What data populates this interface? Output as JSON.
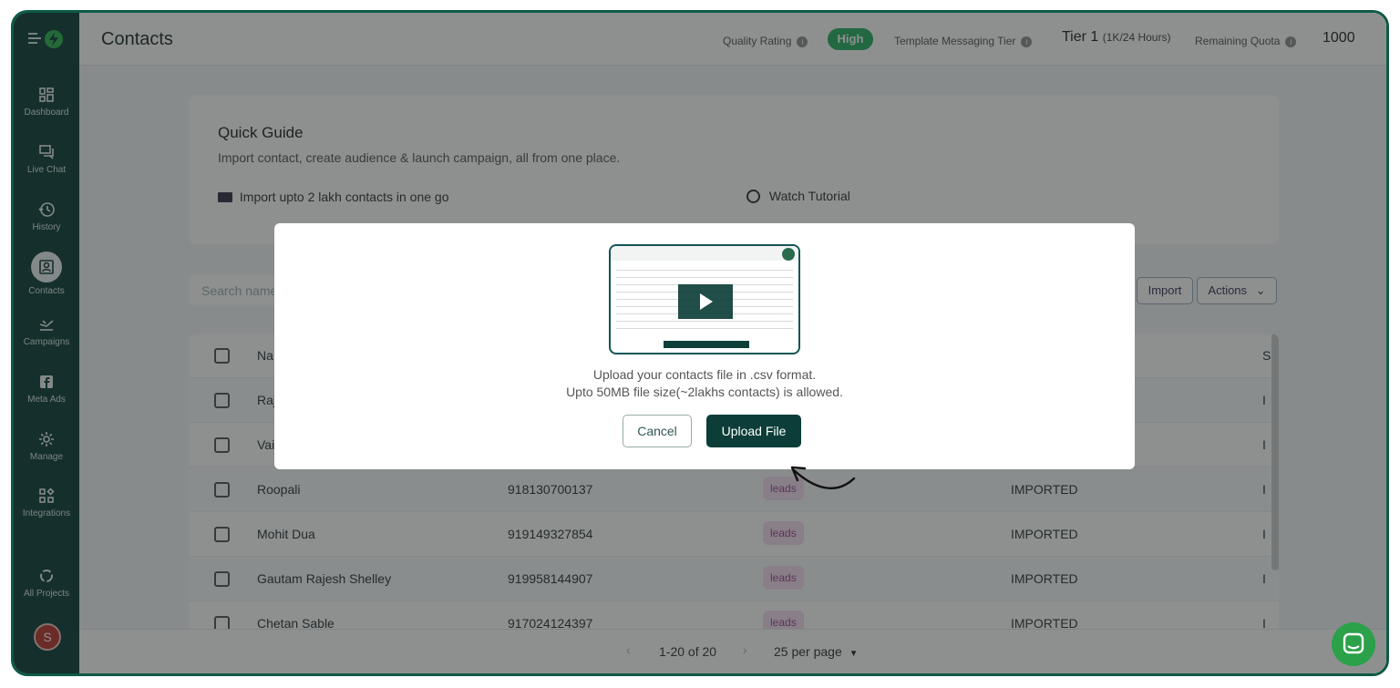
{
  "header": {
    "page_title": "Contacts",
    "quality_rating_label": "Quality Rating",
    "quality_rating_value": "High",
    "template_tier_label": "Template Messaging Tier",
    "tier_value": "Tier 1",
    "tier_detail": "(1K/24 Hours)",
    "remaining_quota_label": "Remaining Quota",
    "remaining_quota_value": "1000"
  },
  "sidebar": {
    "items": [
      {
        "label": "Dashboard",
        "icon": "dashboard-icon"
      },
      {
        "label": "Live Chat",
        "icon": "chat-icon"
      },
      {
        "label": "History",
        "icon": "history-icon"
      },
      {
        "label": "Contacts",
        "icon": "contacts-icon"
      },
      {
        "label": "Campaigns",
        "icon": "campaigns-icon"
      },
      {
        "label": "Meta Ads",
        "icon": "facebook-icon"
      },
      {
        "label": "Manage",
        "icon": "gear-icon"
      },
      {
        "label": "Integrations",
        "icon": "integrations-icon"
      },
      {
        "label": "All Projects",
        "icon": "projects-icon"
      }
    ],
    "avatar_initial": "S"
  },
  "guide": {
    "title": "Quick Guide",
    "subtitle": "Import contact, create audience & launch campaign, all from one place.",
    "import_link": "Import upto 2 lakh contacts in one go",
    "tutorial_link": "Watch Tutorial"
  },
  "toolbar": {
    "search_placeholder": "Search name",
    "import_label": "Import",
    "actions_label": "Actions"
  },
  "table": {
    "header_first": "Na",
    "header_last": "S",
    "rows": [
      {
        "name": "Raj",
        "phone": "",
        "tag": "",
        "status": "",
        "extra": "I"
      },
      {
        "name": "Vai",
        "phone": "",
        "tag": "",
        "status": "",
        "extra": "I"
      },
      {
        "name": "Roopali",
        "phone": "918130700137",
        "tag": "leads",
        "status": "IMPORTED",
        "extra": "I"
      },
      {
        "name": "Mohit Dua",
        "phone": "919149327854",
        "tag": "leads",
        "status": "IMPORTED",
        "extra": "I"
      },
      {
        "name": "Gautam Rajesh Shelley",
        "phone": "919958144907",
        "tag": "leads",
        "status": "IMPORTED",
        "extra": "I"
      },
      {
        "name": "Chetan Sable",
        "phone": "917024124397",
        "tag": "leads",
        "status": "IMPORTED",
        "extra": "I"
      }
    ]
  },
  "pager": {
    "range": "1-20 of 20",
    "per_page": "25 per page"
  },
  "modal": {
    "line1": "Upload your contacts file in .csv format.",
    "line2": "Upto 50MB file size(~2lakhs contacts) is allowed.",
    "cancel_label": "Cancel",
    "upload_label": "Upload File"
  },
  "colors": {
    "brand": "#0c3d39",
    "high_pill": "#27ae60",
    "tag_bg": "#f3dcef",
    "chat_bubble": "#2ba14a"
  }
}
